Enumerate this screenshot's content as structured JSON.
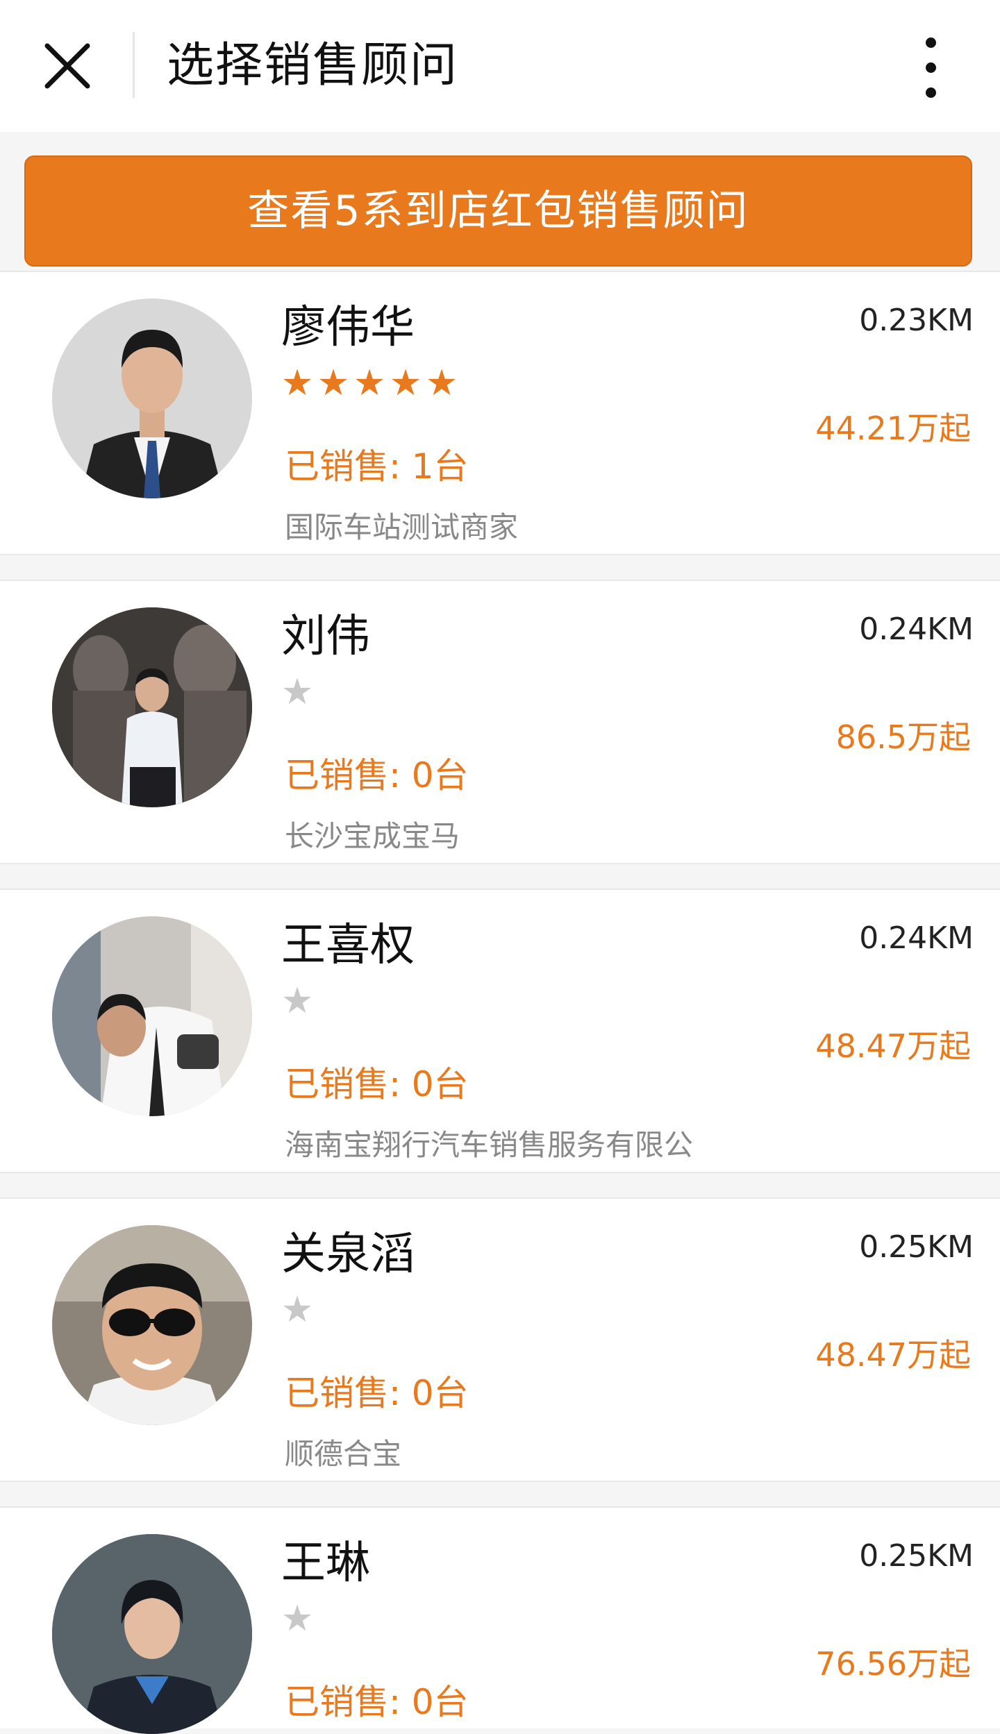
{
  "header": {
    "title": "选择销售顾问"
  },
  "cta": {
    "label": "查看5系到店红包销售顾问"
  },
  "colors": {
    "accent": "#e8791c",
    "star_empty": "#c8c8c8",
    "text_muted": "#888888"
  },
  "consultants": [
    {
      "name": "廖伟华",
      "distance": "0.23KM",
      "rating": 5,
      "sold": "已销售: 1台",
      "price": "44.21万起",
      "dealer": "国际车站测试商家"
    },
    {
      "name": "刘伟",
      "distance": "0.24KM",
      "rating": 0,
      "sold": "已销售: 0台",
      "price": "86.5万起",
      "dealer": "长沙宝成宝马"
    },
    {
      "name": "王喜权",
      "distance": "0.24KM",
      "rating": 0,
      "sold": "已销售: 0台",
      "price": "48.47万起",
      "dealer": "海南宝翔行汽车销售服务有限公"
    },
    {
      "name": "关泉滔",
      "distance": "0.25KM",
      "rating": 0,
      "sold": "已销售: 0台",
      "price": "48.47万起",
      "dealer": "顺德合宝"
    },
    {
      "name": "王琳",
      "distance": "0.25KM",
      "rating": 0,
      "sold": "已销售: 0台",
      "price": "76.56万起",
      "dealer": ""
    }
  ]
}
